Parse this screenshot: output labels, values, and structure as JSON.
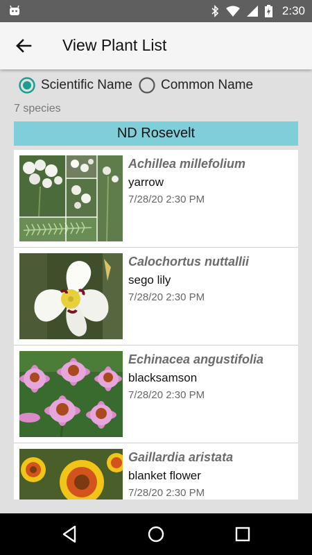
{
  "status_bar": {
    "time": "2:30"
  },
  "app_bar": {
    "title": "View Plant List"
  },
  "name_toggle": {
    "options": [
      {
        "label": "Scientific Name",
        "selected": true
      },
      {
        "label": "Common Name",
        "selected": false
      }
    ]
  },
  "species_count": "7 species",
  "group": {
    "name": "ND Rosevelt"
  },
  "plants": [
    {
      "scientific": "Achillea millefolium",
      "common": "yarrow",
      "date": "7/28/20 2:30 PM"
    },
    {
      "scientific": "Calochortus nuttallii",
      "common": "sego lily",
      "date": "7/28/20 2:30 PM"
    },
    {
      "scientific": "Echinacea angustifolia",
      "common": "blacksamson",
      "date": "7/28/20 2:30 PM"
    },
    {
      "scientific": "Gaillardia aristata",
      "common": "blanket flower",
      "date": "7/28/20 2:30 PM"
    }
  ],
  "colors": {
    "accent": "#1a9e8f",
    "group_header": "#7ecfda",
    "status_bar": "#5f5f5f"
  }
}
